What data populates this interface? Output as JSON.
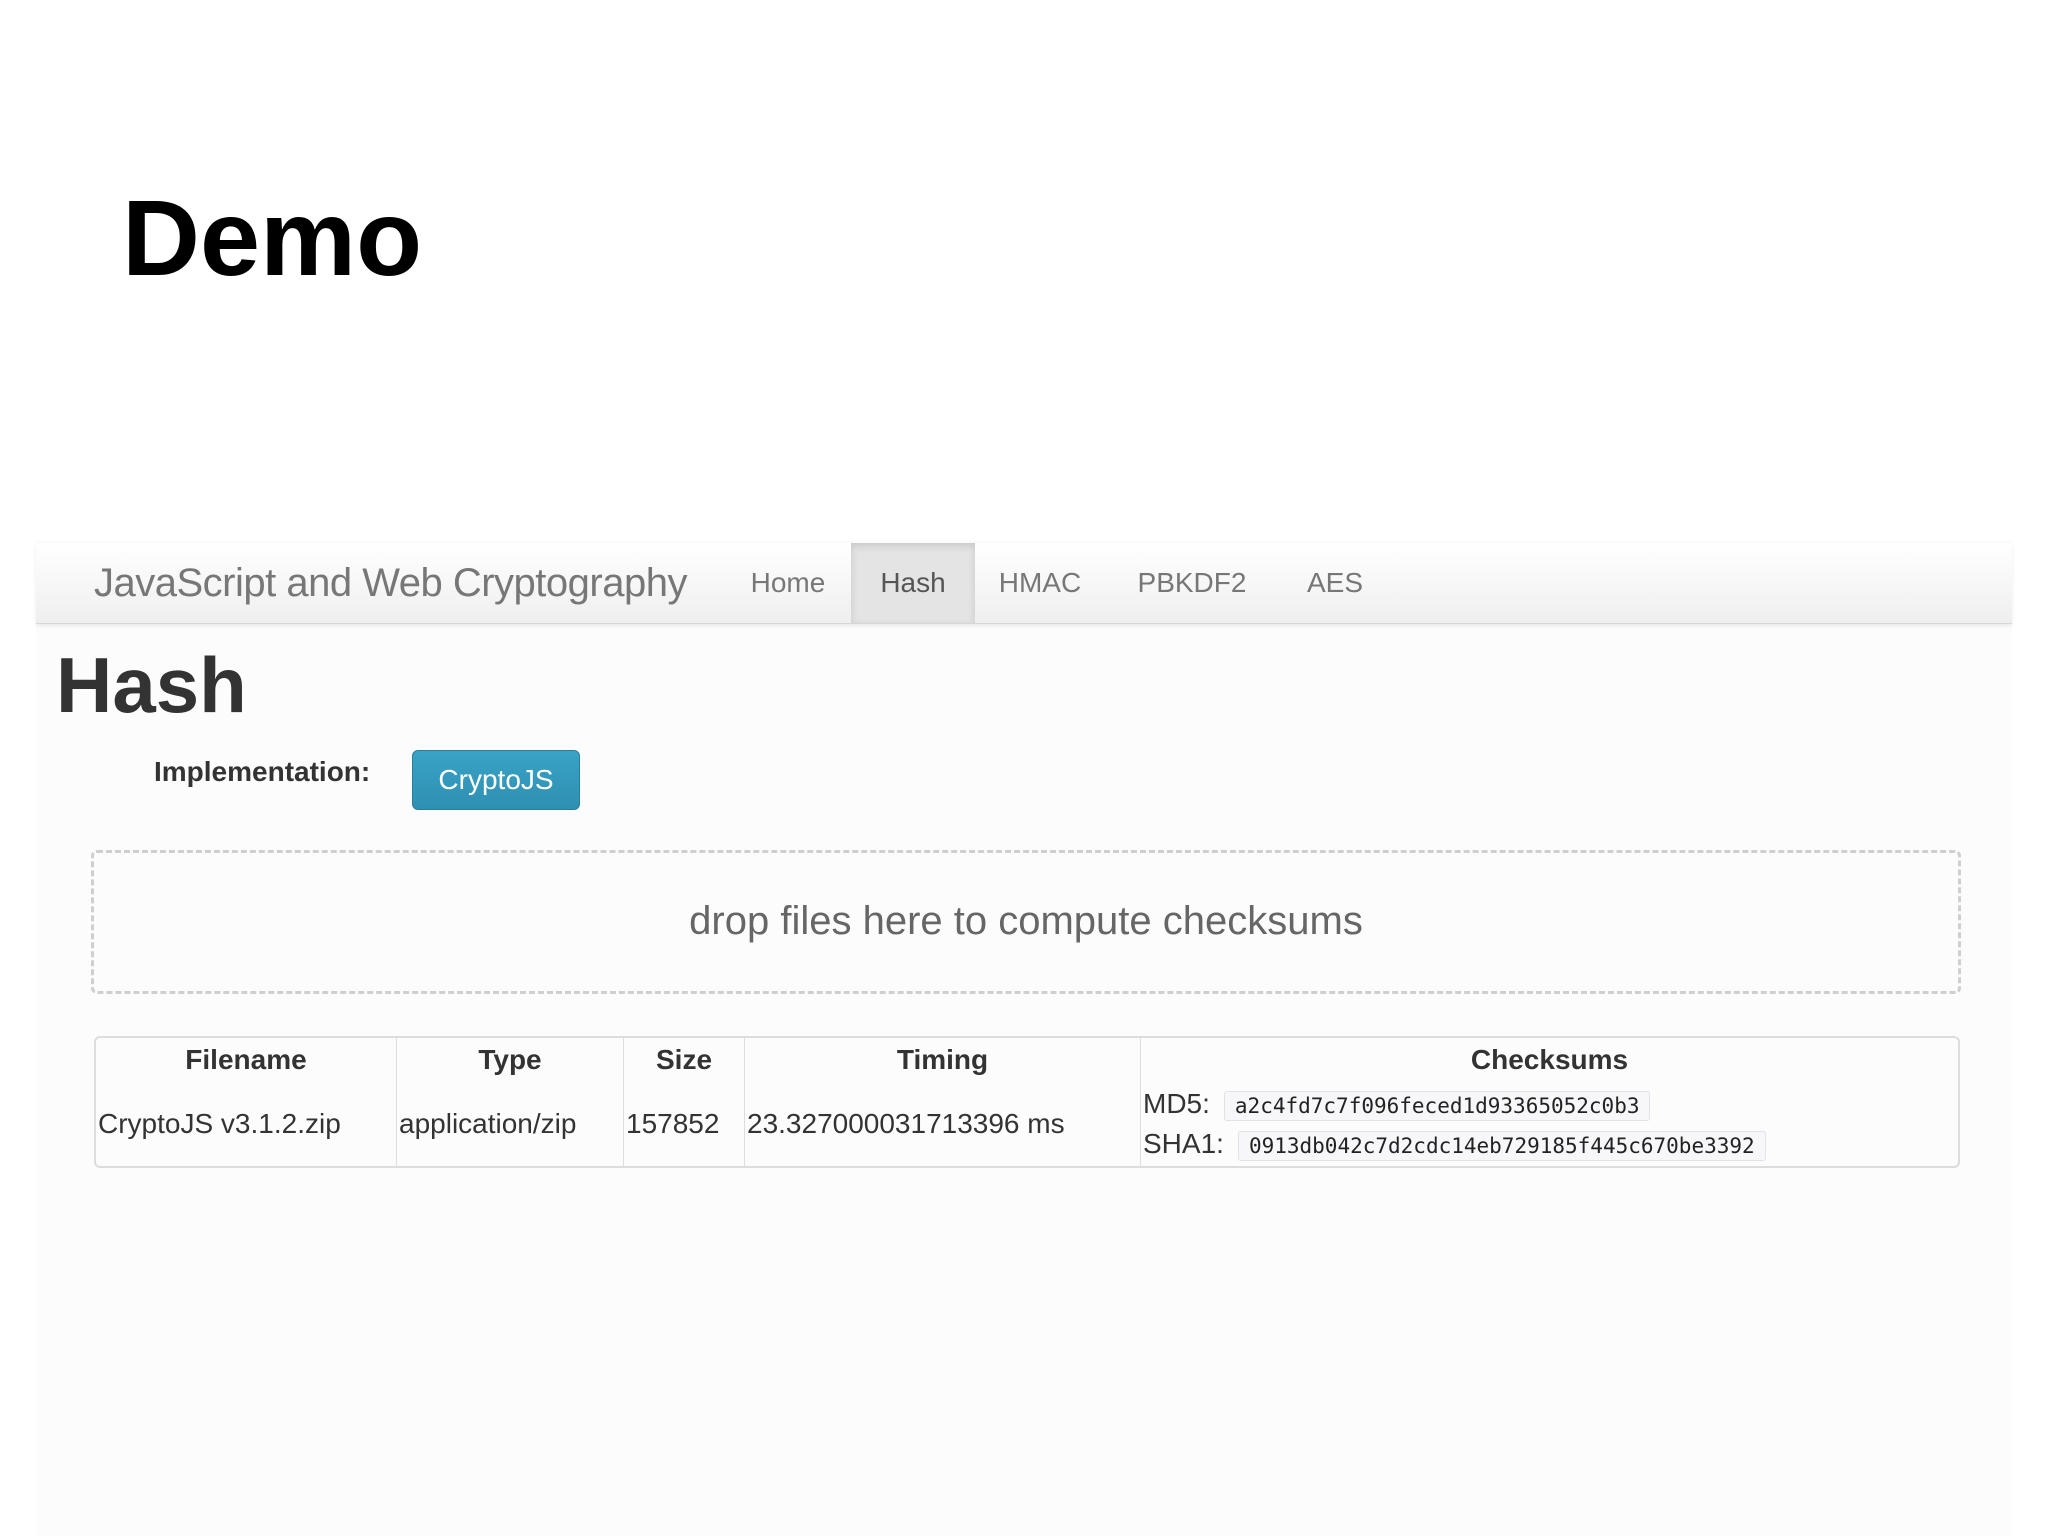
{
  "slide": {
    "title": "Demo"
  },
  "navbar": {
    "brand": "JavaScript and Web Cryptography",
    "items": [
      {
        "label": "Home",
        "active": false
      },
      {
        "label": "Hash",
        "active": true
      },
      {
        "label": "HMAC",
        "active": false
      },
      {
        "label": "PBKDF2",
        "active": false
      },
      {
        "label": "AES",
        "active": false
      }
    ]
  },
  "page": {
    "heading": "Hash",
    "implementation_label": "Implementation:",
    "implementation_button": "CryptoJS",
    "dropzone_text": "drop files here to compute checksums"
  },
  "table": {
    "headers": [
      "Filename",
      "Type",
      "Size",
      "Timing",
      "Checksums"
    ],
    "rows": [
      {
        "filename": "CryptoJS v3.1.2.zip",
        "type": "application/zip",
        "size": "157852",
        "timing": "23.327000031713396 ms",
        "md5_label": "MD5:",
        "md5": "a2c4fd7c7f096feced1d93365052c0b3",
        "sha1_label": "SHA1:",
        "sha1": "0913db042c7d2cdc14eb729185f445c670be3392"
      }
    ]
  },
  "colors": {
    "accent_button": "#2f8fb2",
    "navbar_active": "#e4e4e4"
  }
}
